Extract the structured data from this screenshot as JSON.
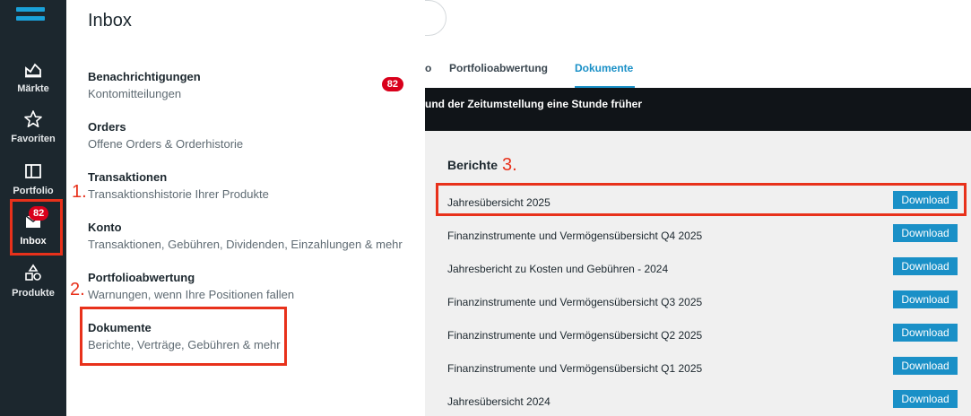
{
  "rail": {
    "items": [
      {
        "label": "Märkte",
        "icon": "chart-icon"
      },
      {
        "label": "Favoriten",
        "icon": "star-icon"
      },
      {
        "label": "Portfolio",
        "icon": "portfolio-icon"
      },
      {
        "label": "Inbox",
        "icon": "inbox-icon",
        "badge": "82"
      },
      {
        "label": "Produkte",
        "icon": "products-icon"
      }
    ]
  },
  "panel": {
    "title": "Inbox",
    "badge": "82",
    "items": [
      {
        "title": "Benachrichtigungen",
        "subtitle": "Kontomitteilungen"
      },
      {
        "title": "Orders",
        "subtitle": "Offene Orders & Orderhistorie"
      },
      {
        "title": "Transaktionen",
        "subtitle": "Transaktionshistorie Ihrer Produkte"
      },
      {
        "title": "Konto",
        "subtitle": "Transaktionen, Gebühren, Dividenden, Einzahlungen & mehr"
      },
      {
        "title": "Portfolioabwertung",
        "subtitle": "Warnungen, wenn Ihre Positionen fallen"
      },
      {
        "title": "Dokumente",
        "subtitle": "Berichte, Verträge, Gebühren & mehr"
      }
    ]
  },
  "main": {
    "tabs": [
      "o",
      "Portfolioabwertung",
      "Dokumente"
    ],
    "banner": "und der Zeitumstellung eine Stunde früher",
    "section_title": "Berichte",
    "download_label": "Download",
    "reports": [
      "Jahresübersicht 2025",
      "Finanzinstrumente und Vermögensübersicht Q4 2025",
      "Jahresbericht zu Kosten und Gebühren - 2024",
      "Finanzinstrumente und Vermögensübersicht Q3 2025",
      "Finanzinstrumente und Vermögensübersicht Q2 2025",
      "Finanzinstrumente und Vermögensübersicht Q1 2025",
      "Jahresübersicht 2024"
    ]
  },
  "annotations": {
    "one": "1.",
    "two": "2.",
    "three": "3."
  },
  "colors": {
    "accent": "#1a90c7",
    "rail": "#1c272e",
    "badge": "#d9001b",
    "annotation": "#e8311b"
  }
}
